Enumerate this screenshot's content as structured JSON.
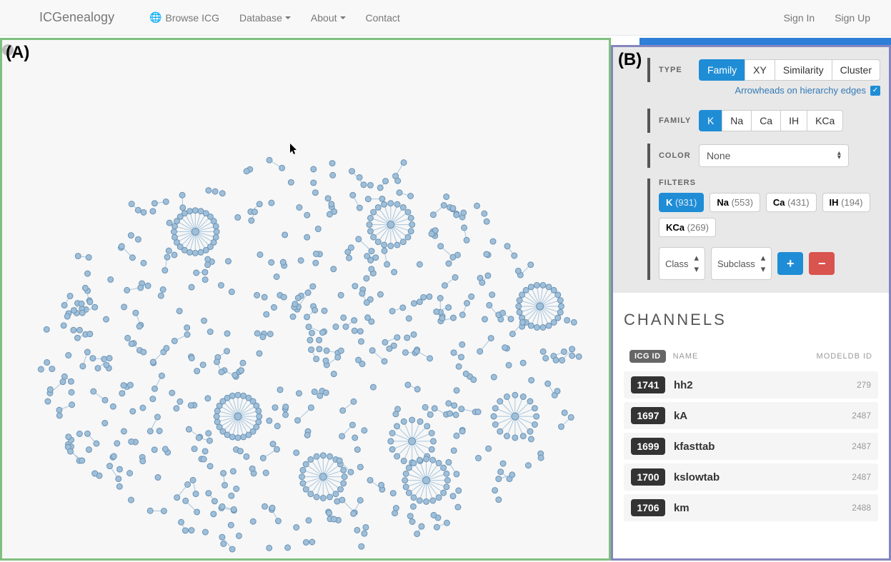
{
  "nav": {
    "brand": "ICGenealogy",
    "browse": "Browse ICG",
    "database": "Database",
    "about": "About",
    "contact": "Contact",
    "signin": "Sign In",
    "signup": "Sign Up"
  },
  "labels": {
    "a": "(A)",
    "b": "(B)"
  },
  "controls": {
    "type_label": "TYPE",
    "type_opts": [
      "Family",
      "XY",
      "Similarity",
      "Cluster"
    ],
    "arrowheads_label": "Arrowheads on hierarchy edges",
    "family_label": "FAMILY",
    "family_opts": [
      "K",
      "Na",
      "Ca",
      "IH",
      "KCa"
    ],
    "color_label": "COLOR",
    "color_value": "None",
    "filters_label": "FILTERS",
    "filter_pills": [
      {
        "name": "K",
        "count": "(931)",
        "active": true
      },
      {
        "name": "Na",
        "count": "(553)",
        "active": false
      },
      {
        "name": "Ca",
        "count": "(431)",
        "active": false
      },
      {
        "name": "IH",
        "count": "(194)",
        "active": false
      },
      {
        "name": "KCa",
        "count": "(269)",
        "active": false
      }
    ],
    "class_label": "Class",
    "subclass_label": "Subclass",
    "plus": "+",
    "minus": "−"
  },
  "channels": {
    "title": "CHANNELS",
    "header_icg": "ICG ID",
    "header_name": "NAME",
    "header_modeldb": "MODELDB ID",
    "rows": [
      {
        "id": "1741",
        "name": "hh2",
        "modeldb": "279"
      },
      {
        "id": "1697",
        "name": "kA",
        "modeldb": "2487"
      },
      {
        "id": "1699",
        "name": "kfasttab",
        "modeldb": "2487"
      },
      {
        "id": "1700",
        "name": "kslowtab",
        "modeldb": "2487"
      },
      {
        "id": "1706",
        "name": "km",
        "modeldb": "2488"
      }
    ]
  }
}
